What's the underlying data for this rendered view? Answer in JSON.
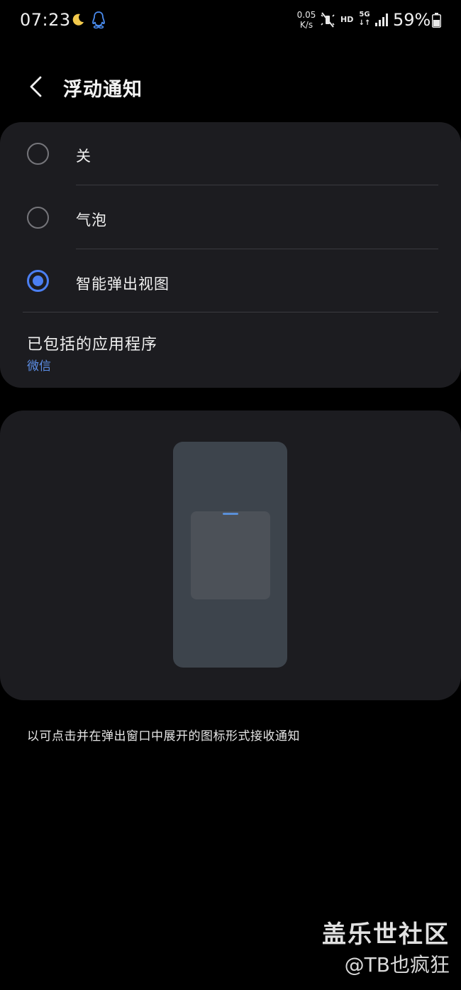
{
  "status_bar": {
    "time": "07:23",
    "net_speed_value": "0.05",
    "net_speed_unit": "K/s",
    "hd": "HD",
    "network": "5G",
    "battery": "59%",
    "icons": [
      "moon-icon",
      "qq-icon",
      "mute-icon",
      "signal-icon",
      "battery-icon"
    ]
  },
  "header": {
    "back_icon": "chevron-left-icon",
    "title": "浮动通知"
  },
  "options": [
    {
      "label": "关",
      "selected": false
    },
    {
      "label": "气泡",
      "selected": false
    },
    {
      "label": "智能弹出视图",
      "selected": true
    }
  ],
  "included_apps": {
    "title": "已包括的应用程序",
    "value": "微信"
  },
  "description": "以可点击并在弹出窗口中展开的图标形式接收通知",
  "watermark": {
    "line1": "盖乐世社区",
    "line2": "@TB也疯狂"
  },
  "colors": {
    "background": "#000000",
    "card": "#1c1c20",
    "accent": "#4b7ff2",
    "link": "#5c8fe8"
  }
}
